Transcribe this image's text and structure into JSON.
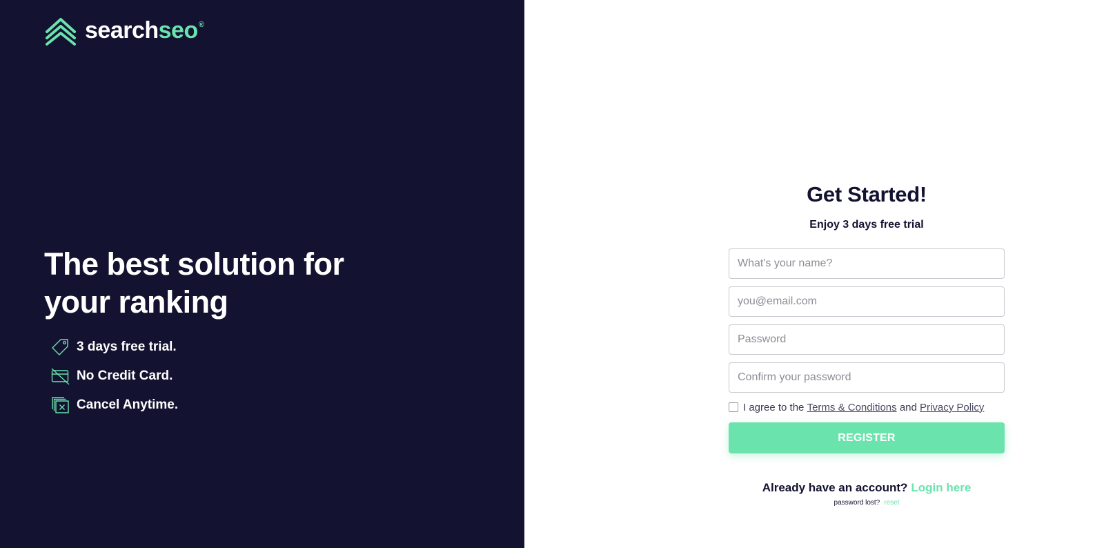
{
  "brand": {
    "name_part1": "search",
    "name_part2": "seo",
    "registered": "®",
    "colors": {
      "dark": "#131230",
      "accent": "#6be3ad"
    },
    "logo_icon": "double-chevron-up-icon"
  },
  "hero": {
    "headline": "The best solution for your ranking",
    "features": [
      {
        "icon": "tag-icon",
        "label": "3 days free trial."
      },
      {
        "icon": "no-credit-card-icon",
        "label": "No Credit Card."
      },
      {
        "icon": "cancel-window-icon",
        "label": "Cancel Anytime."
      }
    ]
  },
  "form": {
    "title": "Get Started!",
    "subtitle": "Enjoy 3 days free trial",
    "name": {
      "placeholder": "What's your name?",
      "value": ""
    },
    "email": {
      "placeholder": "you@email.com",
      "value": ""
    },
    "password": {
      "placeholder": "Password",
      "value": ""
    },
    "confirm_password": {
      "placeholder": "Confirm your password",
      "value": ""
    },
    "agree": {
      "prefix": "I agree to the",
      "terms": "Terms & Conditions",
      "and": "and",
      "privacy": "Privacy Policy",
      "checked": false
    },
    "register_label": "REGISTER"
  },
  "login": {
    "question": "Already have an account?",
    "link": "Login here"
  },
  "reset": {
    "question": "password lost?",
    "link": "reset"
  }
}
